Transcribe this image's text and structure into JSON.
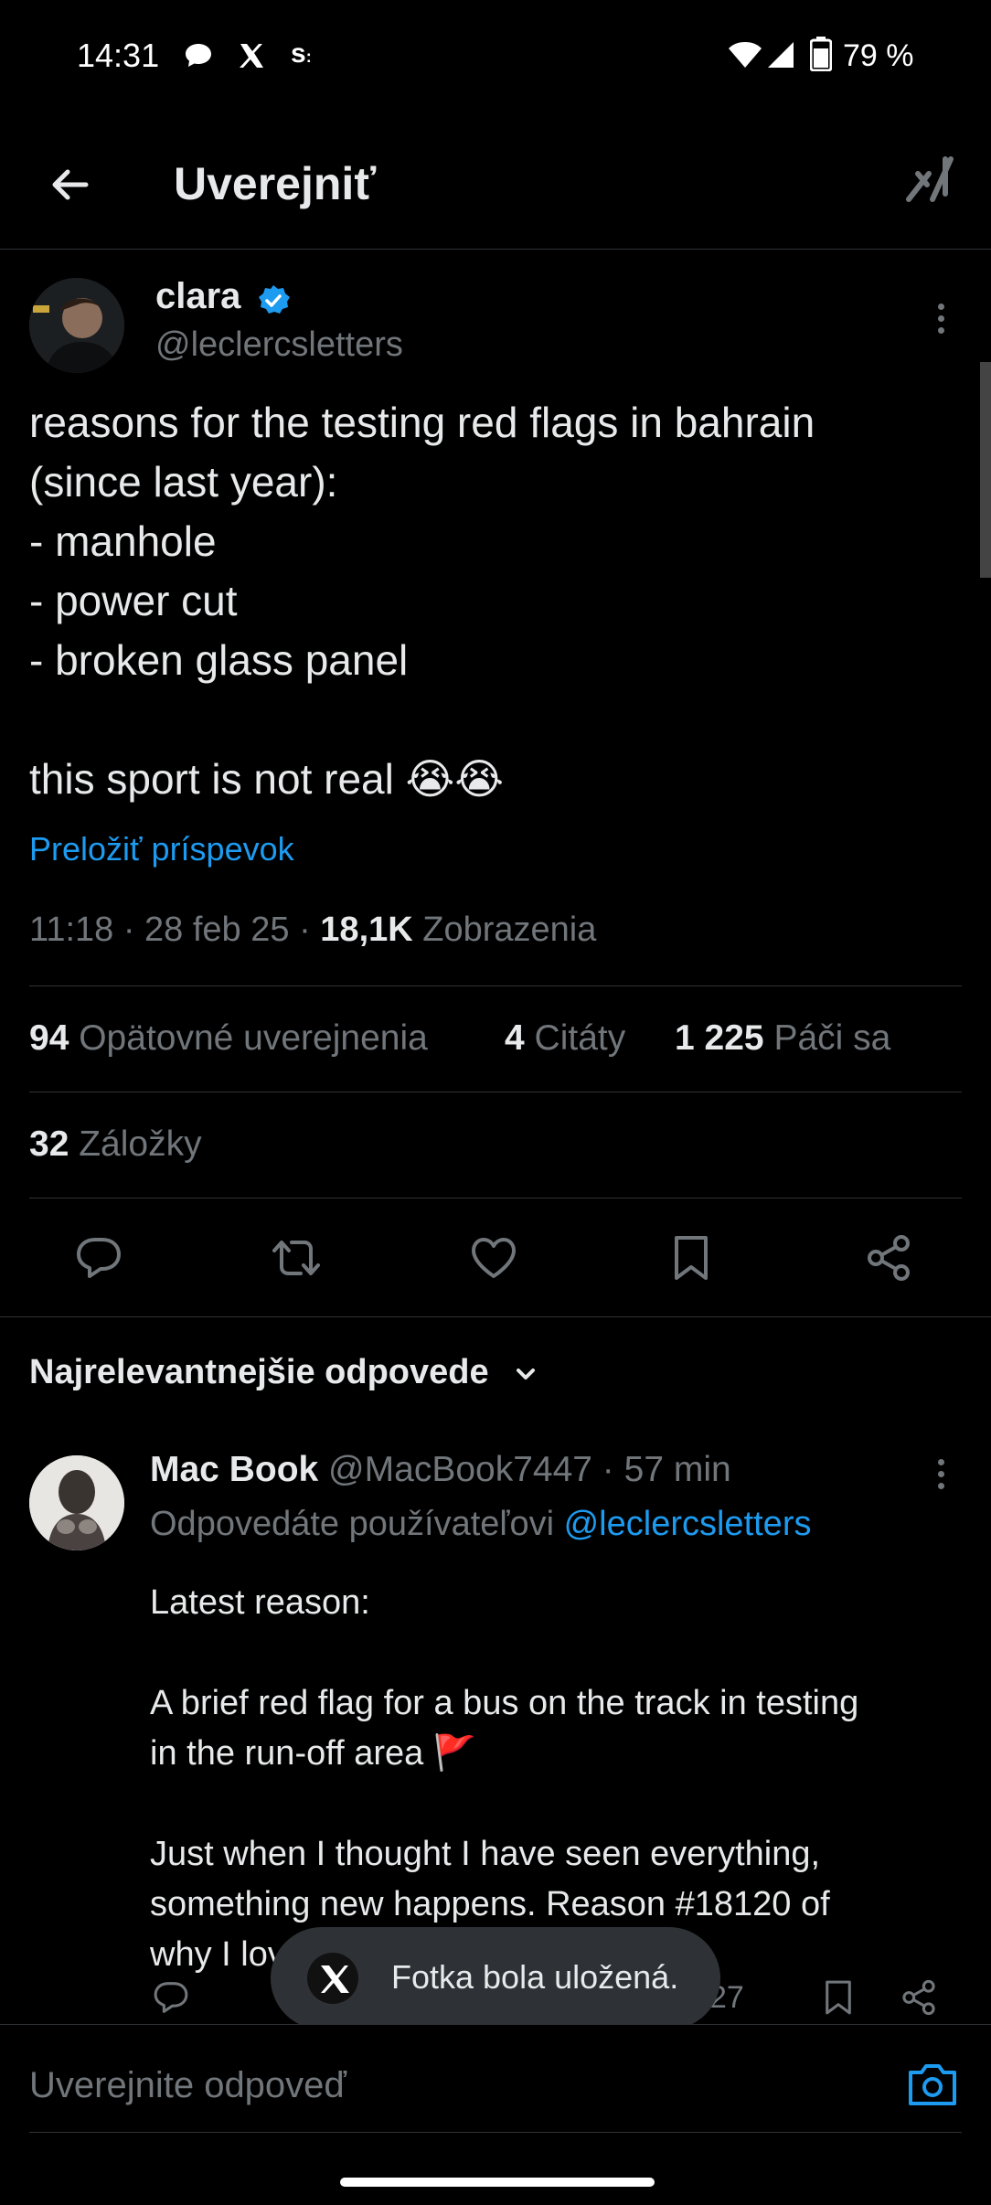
{
  "status_bar": {
    "time": "14:31",
    "battery": "79 %",
    "icons": [
      "chat-bubble-icon",
      "x-logo-icon",
      "s-app-icon",
      "wifi-icon",
      "signal-icon",
      "battery-icon"
    ]
  },
  "header": {
    "title": "Uverejniť",
    "back_icon": "arrow-left-icon",
    "grok_icon": "grok-icon"
  },
  "post": {
    "author_name": "clara",
    "author_handle": "@leclercsletters",
    "verified": true,
    "text": "reasons for the testing red flags in bahrain\n(since last year):\n- manhole\n- power cut\n- broken glass panel\n\nthis sport is not real 😭😭",
    "translate_label": "Preložiť príspevok",
    "time": "11:18 · 28 feb 25 · ",
    "views_count": "18,1K",
    "views_label": " Zobrazenia",
    "reposts_count": "94",
    "reposts_label": " Opätovné uverejnenia",
    "quotes_count": "4",
    "quotes_label": " Citáty",
    "likes_count": "1 225",
    "likes_label": " Páči sa",
    "bookmarks_count": "32",
    "bookmarks_label": " Záložky"
  },
  "replies": {
    "sort_label": "Najrelevantnejšie odpovede",
    "items": [
      {
        "name": "Mac Book",
        "handle": "@MacBook7447",
        "time": " · 57 min",
        "replying_prefix": "Odpovedáte používateľovi ",
        "replying_to": "@leclercsletters",
        "text": "Latest reason:\n\nA brief red flag for a bus on the track in testing\nin the run-off area 🚩\n\nJust when I thought I have seen everything,\nsomething new happens. Reason #18120 of\nwhy I love this sport 🤔🤣😂😁🥳",
        "partial_count": "27"
      }
    ]
  },
  "toast": {
    "text": "Fotka bola uložená."
  },
  "compose": {
    "placeholder": "Uverejnite odpoveď"
  },
  "colors": {
    "background": "#000000",
    "accent": "#1d9bf0",
    "muted": "#71767b",
    "text": "#e7e9ea"
  }
}
